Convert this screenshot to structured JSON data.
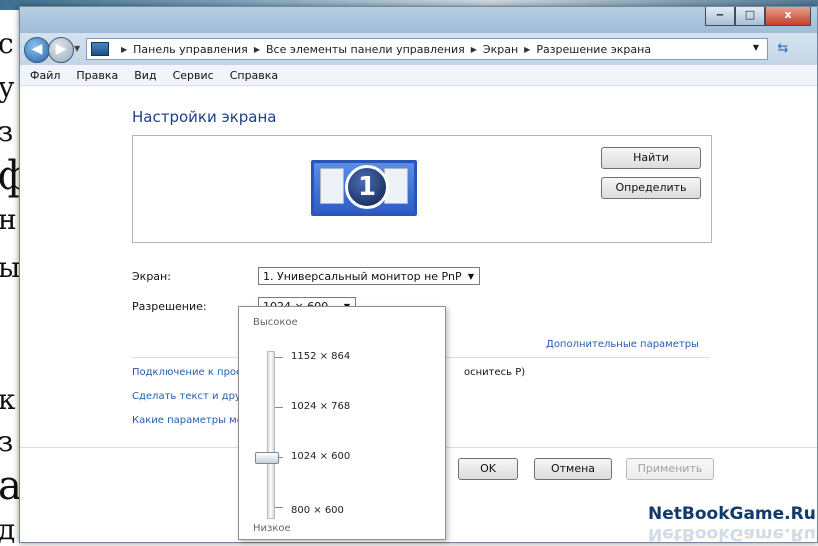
{
  "background_document": {
    "lines": [
      "с",
      "у",
      "з",
      "ф",
      "н",
      "ы",
      "к",
      "з",
      "а",
      "д"
    ]
  },
  "window": {
    "controls": {
      "minimize": "‒",
      "maximize": "□",
      "close": "x"
    }
  },
  "address": {
    "crumbs": [
      "Панель управления",
      "Все элементы панели управления",
      "Экран",
      "Разрешение экрана"
    ],
    "refresh_icon": "refresh-icon"
  },
  "menu": [
    "Файл",
    "Правка",
    "Вид",
    "Сервис",
    "Справка"
  ],
  "page": {
    "title": "Настройки экрана",
    "monitor_number": "1",
    "find_button": "Найти",
    "identify_button": "Определить",
    "screen_label": "Экран:",
    "screen_value": "1. Универсальный монитор не PnP",
    "resolution_label": "Разрешение:",
    "resolution_value": "1024 × 600",
    "advanced_link": "Дополнительные параметры",
    "links": [
      "Подключение к проек",
      "Сделать текст и други",
      "Какие параметры мон"
    ],
    "link_fragment": "оснитесь P)",
    "ok_button": "OK",
    "cancel_button": "Отмена",
    "apply_button": "Применить",
    "watermark": "NetBookGame.Ru"
  },
  "resolution_dropdown": {
    "high_label": "Высокое",
    "low_label": "Низкое",
    "options": [
      "1152 × 864",
      "1024 × 768",
      "1024 × 600",
      "800 × 600"
    ],
    "selected_index": 2
  },
  "colors": {
    "title_blue": "#1e3f8a",
    "link_blue": "#1e5fb4",
    "monitor_blue": "#2a54b6"
  }
}
